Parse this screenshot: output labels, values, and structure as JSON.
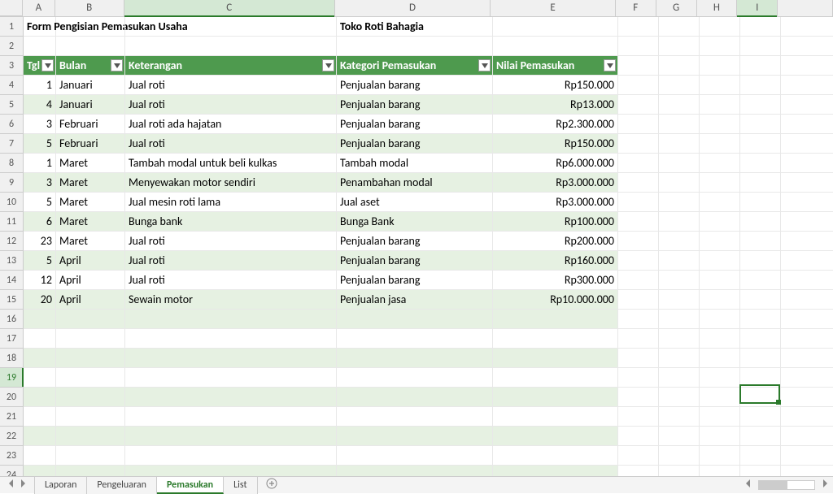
{
  "columns": [
    "A",
    "B",
    "C",
    "D",
    "E",
    "F",
    "G",
    "H",
    "I"
  ],
  "active_column": "C",
  "selected_column": "I",
  "rows_visible": 24,
  "active_row": 19,
  "title_row": {
    "A": "Form Pengisian Pemasukan Usaha",
    "D": "Toko Roti Bahagia"
  },
  "table": {
    "headers": {
      "A": "Tgl",
      "B": "Bulan",
      "C": "Keterangan",
      "D": "Kategori Pemasukan",
      "E": "Nilai Pemasukan"
    },
    "rows": [
      {
        "tgl": "1",
        "bulan": "Januari",
        "ket": "Jual roti",
        "kat": "Penjualan barang",
        "nilai": "Rp150.000"
      },
      {
        "tgl": "4",
        "bulan": "Januari",
        "ket": "Jual roti",
        "kat": "Penjualan barang",
        "nilai": "Rp13.000"
      },
      {
        "tgl": "3",
        "bulan": "Februari",
        "ket": "Jual roti ada hajatan",
        "kat": "Penjualan barang",
        "nilai": "Rp2.300.000"
      },
      {
        "tgl": "5",
        "bulan": "Februari",
        "ket": "Jual roti",
        "kat": "Penjualan barang",
        "nilai": "Rp150.000"
      },
      {
        "tgl": "1",
        "bulan": "Maret",
        "ket": "Tambah modal untuk beli kulkas",
        "kat": "Tambah modal",
        "nilai": "Rp6.000.000"
      },
      {
        "tgl": "3",
        "bulan": "Maret",
        "ket": "Menyewakan motor sendiri",
        "kat": "Penambahan modal",
        "nilai": "Rp3.000.000"
      },
      {
        "tgl": "5",
        "bulan": "Maret",
        "ket": "Jual mesin roti lama",
        "kat": "Jual aset",
        "nilai": "Rp3.000.000"
      },
      {
        "tgl": "6",
        "bulan": "Maret",
        "ket": "Bunga bank",
        "kat": "Bunga Bank",
        "nilai": "Rp100.000"
      },
      {
        "tgl": "23",
        "bulan": "Maret",
        "ket": "Jual roti",
        "kat": "Penjualan barang",
        "nilai": "Rp200.000"
      },
      {
        "tgl": "5",
        "bulan": "April",
        "ket": "Jual roti",
        "kat": "Penjualan barang",
        "nilai": "Rp160.000"
      },
      {
        "tgl": "12",
        "bulan": "April",
        "ket": "Jual roti",
        "kat": "Penjualan barang",
        "nilai": "Rp300.000"
      },
      {
        "tgl": "20",
        "bulan": "April",
        "ket": "Sewain motor",
        "kat": "Penjualan jasa",
        "nilai": "Rp10.000.000"
      }
    ]
  },
  "tabs": {
    "items": [
      "Laporan",
      "Pengeluaran",
      "Pemasukan",
      "List"
    ],
    "active": "Pemasukan"
  }
}
